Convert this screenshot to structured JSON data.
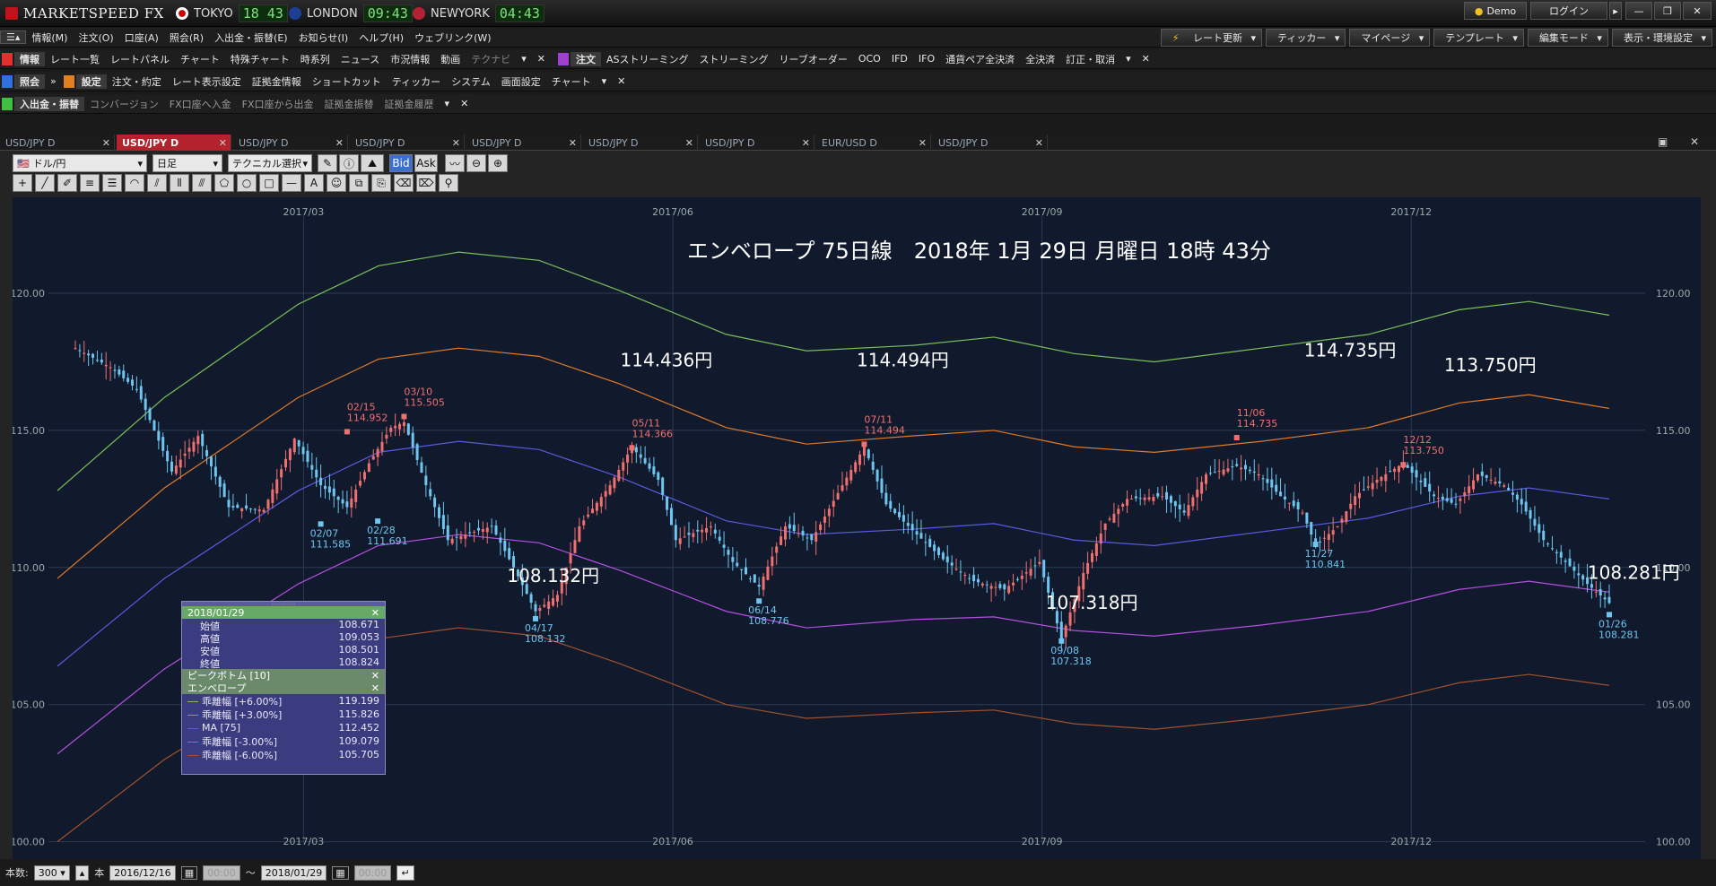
{
  "app": {
    "logo": "MARKETSPEED FX"
  },
  "clocks": [
    {
      "city": "TOKYO",
      "time": "18 43"
    },
    {
      "city": "LONDON",
      "time": "09:43"
    },
    {
      "city": "NEWYORK",
      "time": "04:43"
    }
  ],
  "topright": {
    "demo": "Demo",
    "login": "ログイン"
  },
  "menu": [
    "情報(M)",
    "注文(O)",
    "口座(A)",
    "照会(R)",
    "入出金・振替(E)",
    "お知らせ(I)",
    "ヘルプ(H)",
    "ウェブリンク(W)"
  ],
  "toolbar_right": [
    "レート更新",
    "ティッカー",
    "マイページ",
    "テンプレート",
    "編集モード",
    "表示・環境設定"
  ],
  "row1": {
    "group1": "情報",
    "items1": [
      "レート一覧",
      "レートパネル",
      "チャート",
      "特殊チャート",
      "時系列",
      "ニュース",
      "市況情報",
      "動画",
      "テクナビ"
    ],
    "group2": "注文",
    "items2": [
      "ASストリーミング",
      "ストリーミング",
      "リーブオーダー",
      "OCO",
      "IFD",
      "IFO",
      "通貨ペア全決済",
      "全決済",
      "訂正・取消"
    ]
  },
  "row2": {
    "group1": "照会",
    "group2": "設定",
    "items2": [
      "注文・約定",
      "レート表示設定",
      "証拠金情報",
      "ショートカット",
      "ティッカー",
      "システム",
      "画面設定",
      "チャート"
    ]
  },
  "row3": {
    "group1": "入出金・振替",
    "items": [
      "コンバージョン",
      "FX口座へ入金",
      "FX口座から出金",
      "証拠金振替",
      "証拠金履歴"
    ]
  },
  "tabs": [
    "USD/JPY D",
    "USD/JPY D",
    "USD/JPY D",
    "USD/JPY D",
    "USD/JPY D",
    "USD/JPY D",
    "USD/JPY D",
    "EUR/USD D",
    "USD/JPY D"
  ],
  "controls": {
    "pair": "ドル/円",
    "period": "日足",
    "tech": "テクニカル選択",
    "bid": "Bid",
    "ask": "Ask"
  },
  "chart_data": {
    "type": "line",
    "title": "エンベロープ 75日線　2018年 1月 29日 月曜日 18時 43分",
    "x_ticks": [
      "2017/03",
      "2017/06",
      "2017/09",
      "2017/12"
    ],
    "y_ticks": [
      "120.00",
      "115.00",
      "110.00",
      "105.00",
      "100.00"
    ],
    "ylim": [
      99.3,
      123.5
    ],
    "n_days": 290,
    "series": [
      {
        "name": "乖離幅 [+6.00%]",
        "color": "#7dbf5a",
        "values": [
          [
            0,
            112.8
          ],
          [
            20,
            116.2
          ],
          [
            45,
            119.6
          ],
          [
            60,
            121.0
          ],
          [
            75,
            121.5
          ],
          [
            90,
            121.2
          ],
          [
            105,
            120.1
          ],
          [
            125,
            118.5
          ],
          [
            140,
            117.9
          ],
          [
            160,
            118.1
          ],
          [
            175,
            118.4
          ],
          [
            190,
            117.8
          ],
          [
            205,
            117.5
          ],
          [
            225,
            118.0
          ],
          [
            245,
            118.5
          ],
          [
            262,
            119.4
          ],
          [
            275,
            119.7
          ],
          [
            290,
            119.2
          ]
        ]
      },
      {
        "name": "乖離幅 [+3.00%]",
        "color": "#e07a2a",
        "values": [
          [
            0,
            109.6
          ],
          [
            20,
            112.9
          ],
          [
            45,
            116.2
          ],
          [
            60,
            117.6
          ],
          [
            75,
            118.0
          ],
          [
            90,
            117.7
          ],
          [
            105,
            116.7
          ],
          [
            125,
            115.1
          ],
          [
            140,
            114.5
          ],
          [
            160,
            114.8
          ],
          [
            175,
            115.0
          ],
          [
            190,
            114.4
          ],
          [
            205,
            114.2
          ],
          [
            225,
            114.6
          ],
          [
            245,
            115.1
          ],
          [
            262,
            116.0
          ],
          [
            275,
            116.3
          ],
          [
            290,
            115.8
          ]
        ]
      },
      {
        "name": "MA [75]",
        "color": "#5a5ae0",
        "values": [
          [
            0,
            106.4
          ],
          [
            20,
            109.6
          ],
          [
            45,
            112.8
          ],
          [
            60,
            114.2
          ],
          [
            75,
            114.6
          ],
          [
            90,
            114.3
          ],
          [
            105,
            113.3
          ],
          [
            125,
            111.7
          ],
          [
            140,
            111.2
          ],
          [
            160,
            111.4
          ],
          [
            175,
            111.6
          ],
          [
            190,
            111.0
          ],
          [
            205,
            110.8
          ],
          [
            225,
            111.3
          ],
          [
            245,
            111.8
          ],
          [
            262,
            112.6
          ],
          [
            275,
            112.9
          ],
          [
            290,
            112.5
          ]
        ]
      },
      {
        "name": "乖離幅 [-3.00%]",
        "color": "#b44fe0",
        "values": [
          [
            0,
            103.2
          ],
          [
            20,
            106.3
          ],
          [
            45,
            109.4
          ],
          [
            60,
            110.8
          ],
          [
            75,
            111.2
          ],
          [
            90,
            110.9
          ],
          [
            105,
            109.9
          ],
          [
            125,
            108.4
          ],
          [
            140,
            107.8
          ],
          [
            160,
            108.1
          ],
          [
            175,
            108.2
          ],
          [
            190,
            107.7
          ],
          [
            205,
            107.5
          ],
          [
            225,
            107.9
          ],
          [
            245,
            108.4
          ],
          [
            262,
            109.2
          ],
          [
            275,
            109.5
          ],
          [
            290,
            109.1
          ]
        ]
      },
      {
        "name": "乖離幅 [-6.00%]",
        "color": "#a0522d",
        "values": [
          [
            0,
            100.0
          ],
          [
            20,
            103.0
          ],
          [
            45,
            106.0
          ],
          [
            60,
            107.4
          ],
          [
            75,
            107.8
          ],
          [
            90,
            107.5
          ],
          [
            105,
            106.5
          ],
          [
            125,
            105.0
          ],
          [
            140,
            104.5
          ],
          [
            160,
            104.7
          ],
          [
            175,
            104.8
          ],
          [
            190,
            104.3
          ],
          [
            205,
            104.1
          ],
          [
            225,
            104.5
          ],
          [
            245,
            105.0
          ],
          [
            262,
            105.8
          ],
          [
            275,
            106.1
          ],
          [
            290,
            105.7
          ]
        ]
      }
    ],
    "price_path": [
      [
        0,
        118.0
      ],
      [
        8,
        117.3
      ],
      [
        14,
        116.5
      ],
      [
        22,
        113.5
      ],
      [
        28,
        114.8
      ],
      [
        35,
        112.2
      ],
      [
        43,
        112.1
      ],
      [
        50,
        114.7
      ],
      [
        56,
        113.0
      ],
      [
        62,
        112.2
      ],
      [
        67,
        113.8
      ],
      [
        72,
        115.1
      ],
      [
        75,
        115.3
      ],
      [
        80,
        113.0
      ],
      [
        85,
        111.0
      ],
      [
        95,
        111.5
      ],
      [
        100,
        110.0
      ],
      [
        105,
        108.4
      ],
      [
        110,
        109.0
      ],
      [
        115,
        111.5
      ],
      [
        122,
        113.0
      ],
      [
        127,
        114.4
      ],
      [
        133,
        113.2
      ],
      [
        137,
        111.0
      ],
      [
        145,
        111.5
      ],
      [
        150,
        110.2
      ],
      [
        156,
        109.3
      ],
      [
        162,
        111.5
      ],
      [
        168,
        111.0
      ],
      [
        175,
        113.0
      ],
      [
        180,
        114.4
      ],
      [
        185,
        112.3
      ],
      [
        192,
        111.2
      ],
      [
        198,
        110.3
      ],
      [
        205,
        109.5
      ],
      [
        212,
        109.2
      ],
      [
        220,
        110.2
      ],
      [
        225,
        107.4
      ],
      [
        230,
        109.8
      ],
      [
        235,
        111.6
      ],
      [
        240,
        112.5
      ],
      [
        248,
        112.6
      ],
      [
        253,
        112.0
      ],
      [
        258,
        113.4
      ],
      [
        265,
        113.7
      ],
      [
        270,
        113.4
      ],
      [
        275,
        112.6
      ],
      [
        280,
        112.0
      ],
      [
        283,
        110.8
      ],
      [
        288,
        111.5
      ],
      [
        292,
        112.6
      ],
      [
        297,
        113.2
      ],
      [
        303,
        113.8
      ],
      [
        310,
        112.6
      ],
      [
        315,
        112.3
      ],
      [
        320,
        113.4
      ],
      [
        326,
        113.0
      ],
      [
        330,
        112.3
      ],
      [
        335,
        111.0
      ],
      [
        340,
        110.2
      ],
      [
        345,
        109.4
      ],
      [
        350,
        108.7
      ]
    ],
    "price_path_scale": 350,
    "price_labels": [
      {
        "date": "02/15",
        "value": "114.952",
        "i": 62,
        "pos": "high"
      },
      {
        "date": "03/10",
        "value": "115.505",
        "i": 75,
        "pos": "high"
      },
      {
        "date": "05/11",
        "value": "114.366",
        "i": 127,
        "pos": "high"
      },
      {
        "date": "07/11",
        "value": "114.494",
        "i": 180,
        "pos": "high"
      },
      {
        "date": "11/06",
        "value": "114.735",
        "i": 265,
        "pos": "high"
      },
      {
        "date": "12/12",
        "value": "113.750",
        "i": 303,
        "pos": "high"
      },
      {
        "date": "02/07",
        "value": "111.585",
        "i": 56,
        "pos": "low"
      },
      {
        "date": "02/28",
        "value": "111.691",
        "i": 69,
        "pos": "low"
      },
      {
        "date": "04/17",
        "value": "108.132",
        "i": 105,
        "pos": "low"
      },
      {
        "date": "06/14",
        "value": "108.776",
        "i": 156,
        "pos": "low"
      },
      {
        "date": "09/08",
        "value": "107.318",
        "i": 225,
        "pos": "low"
      },
      {
        "date": "11/27",
        "value": "110.841",
        "i": 283,
        "pos": "low"
      },
      {
        "date": "01/26",
        "value": "108.281",
        "i": 350,
        "pos": "low"
      }
    ],
    "big_labels": [
      {
        "text": "114.436円",
        "x": 0.36,
        "y": 0.255
      },
      {
        "text": "114.494円",
        "x": 0.5,
        "y": 0.255
      },
      {
        "text": "114.735円",
        "x": 0.765,
        "y": 0.24
      },
      {
        "text": "113.750円",
        "x": 0.848,
        "y": 0.262
      },
      {
        "text": "108.132円",
        "x": 0.293,
        "y": 0.58
      },
      {
        "text": "107.318円",
        "x": 0.612,
        "y": 0.62
      },
      {
        "text": "108.281円",
        "x": 0.933,
        "y": 0.575
      }
    ]
  },
  "info": {
    "date": "2018/01/29",
    "ohlc": [
      {
        "label": "始値",
        "value": "108.671"
      },
      {
        "label": "高値",
        "value": "109.053"
      },
      {
        "label": "安値",
        "value": "108.501"
      },
      {
        "label": "終値",
        "value": "108.824"
      }
    ],
    "peak": "ピークボトム [10]",
    "env": "エンベロープ",
    "lines": [
      {
        "label": "乖離幅 [+6.00%]",
        "value": "119.199",
        "color": "#7dbf5a"
      },
      {
        "label": "乖離幅 [+3.00%]",
        "value": "115.826",
        "color": "#e07a2a"
      },
      {
        "label": "MA [75]",
        "value": "112.452",
        "color": "#5a5ae0"
      },
      {
        "label": "乖離幅 [-3.00%]",
        "value": "109.079",
        "color": "#b44fe0"
      },
      {
        "label": "乖離幅 [-6.00%]",
        "value": "105.705",
        "color": "#a0522d"
      }
    ]
  },
  "status": {
    "count_label": "本数:",
    "count": "300",
    "unit": "本",
    "from": "2016/12/16",
    "to": "2018/01/29",
    "time_placeholder": "00:00",
    "tilde": "〜"
  }
}
